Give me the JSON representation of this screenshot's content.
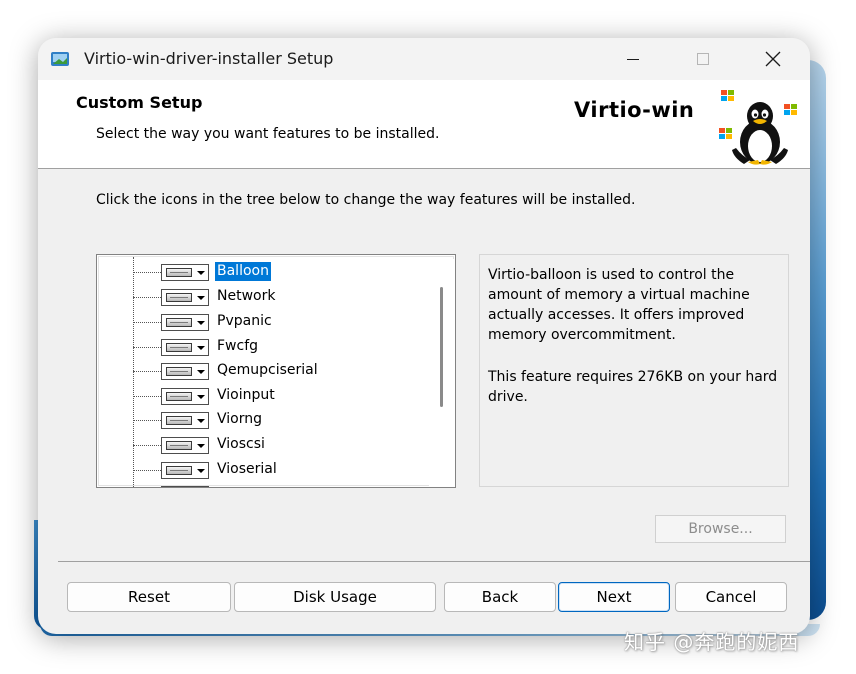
{
  "window": {
    "title": "Virtio-win-driver-installer Setup",
    "app_icon": "installer-icon",
    "controls": {
      "minimize_icon": "minimize-icon",
      "maximize_icon": "maximize-icon",
      "close_icon": "close-icon"
    }
  },
  "header": {
    "title": "Custom Setup",
    "subtitle": "Select the way you want features to be installed.",
    "logo_text": "Virtio-win",
    "logo_image": "tux-penguin-windows-logo"
  },
  "instruction": "Click the icons in the tree below to change the way features will be installed.",
  "feature_tree": {
    "items": [
      {
        "label": "Balloon",
        "selected": true
      },
      {
        "label": "Network",
        "selected": false
      },
      {
        "label": "Pvpanic",
        "selected": false
      },
      {
        "label": "Fwcfg",
        "selected": false
      },
      {
        "label": "Qemupciserial",
        "selected": false
      },
      {
        "label": "Vioinput",
        "selected": false
      },
      {
        "label": "Viorng",
        "selected": false
      },
      {
        "label": "Vioscsi",
        "selected": false
      },
      {
        "label": "Vioserial",
        "selected": false
      }
    ],
    "item_icon": "hard-drive-dropdown-icon"
  },
  "description": {
    "text": "Virtio-balloon is used to control the amount of memory a virtual machine actually accesses. It offers improved memory overcommitment.",
    "requirement": "This feature requires 276KB on your hard drive."
  },
  "browse_button": {
    "label": "Browse...",
    "enabled": false
  },
  "buttons": {
    "reset": "Reset",
    "disk_usage": "Disk Usage",
    "back": "Back",
    "next": "Next",
    "cancel": "Cancel"
  },
  "watermark": "知乎 @奔跑的妮西",
  "colors": {
    "selection": "#0078d7",
    "window_bg": "#f0f0f0",
    "header_bg": "#ffffff",
    "primary_button_border": "#0067c0"
  }
}
